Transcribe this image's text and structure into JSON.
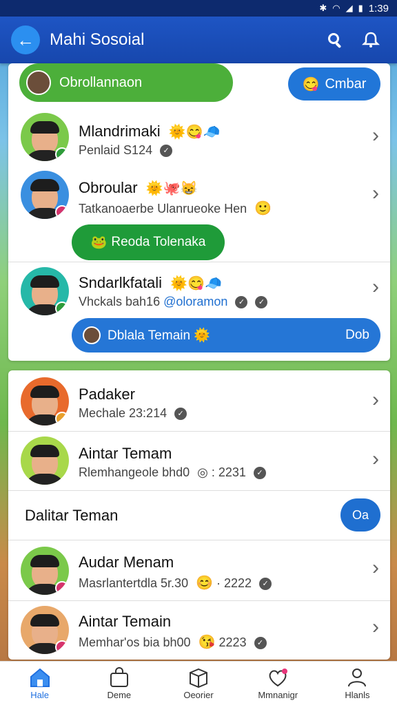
{
  "status": {
    "time": "1:39"
  },
  "appbar": {
    "title": "Mahi Sosoial"
  },
  "top": {
    "pill_label": "Obrollannaon",
    "button_label": "Cmbar"
  },
  "card1": {
    "rows": [
      {
        "name": "Mlandrimaki",
        "sub": "Penlaid S124"
      },
      {
        "name": "Obroular",
        "sub": "Tatkanoaerbe Ulanrueoke Hen"
      },
      {
        "name": "Sndarlkfatali",
        "sub": "Vhckals bah16",
        "sub_link": "@oloramon"
      }
    ],
    "green_button": "Reoda Tolenaka",
    "blue_button": {
      "label": "Dblala Temain",
      "right": "Dob"
    }
  },
  "card2": {
    "rows": [
      {
        "name": "Padaker",
        "sub": "Mechale 23:214"
      },
      {
        "name": "Aintar Temam",
        "sub": "Rlemhangeole bhd0",
        "sub_extra": ": 2231"
      }
    ],
    "section_title": "Dalitar Teman",
    "section_button": "Oa",
    "rows2": [
      {
        "name": "Audar Menam",
        "sub": "Masrlantertdla 5r.30",
        "sub_extra": "· 2222"
      },
      {
        "name": "Aintar Temain",
        "sub": "Memhar'os bia bh00",
        "sub_extra": "2223"
      }
    ]
  },
  "nav": [
    {
      "label": "Hale"
    },
    {
      "label": "Deme"
    },
    {
      "label": "Oeorier"
    },
    {
      "label": "Mmnanigr"
    },
    {
      "label": "Hlanls"
    }
  ],
  "colors": {
    "primary": "#1747ad",
    "accent": "#2176d8",
    "green": "#4caf3a"
  }
}
